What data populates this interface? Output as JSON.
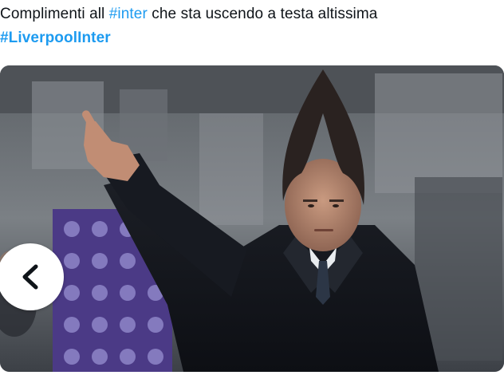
{
  "tweet": {
    "text_prefix": "Complimenti all ",
    "hashtag_inline": "#inter",
    "text_suffix": " che sta uscendo a testa altissima",
    "hashtag_line2": "#LiverpoolInter"
  },
  "media": {
    "description_icon": "photo",
    "nav_prev_icon": "chevron-left-icon"
  },
  "colors": {
    "text": "#0f1419",
    "hashtag": "#1d9bf0",
    "button_bg": "#ffffff"
  }
}
